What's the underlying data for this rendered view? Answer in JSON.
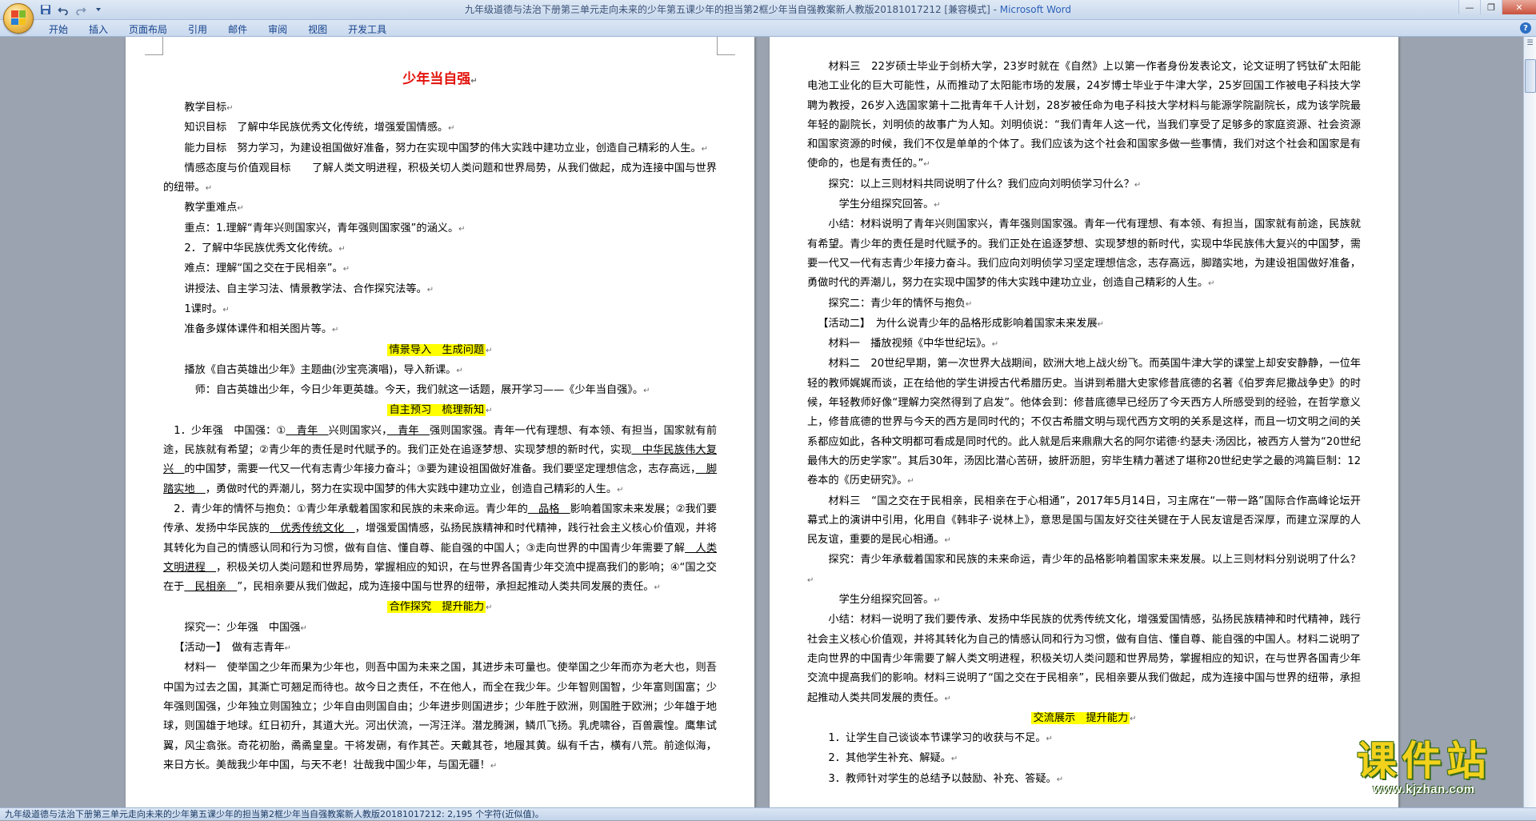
{
  "window": {
    "doc_title": "九年级道德与法治下册第三单元走向未来的少年第五课少年的担当第2框少年当自强教案新人教版20181017212 [兼容模式] - ",
    "app_name": "Microsoft Word"
  },
  "quick_access": {
    "save_icon": "save-icon",
    "undo_icon": "undo-icon",
    "redo_icon": "redo-icon",
    "customize_icon": "customize-qat-icon"
  },
  "ribbon": {
    "tabs": [
      "开始",
      "插入",
      "页面布局",
      "引用",
      "邮件",
      "审阅",
      "视图",
      "开发工具"
    ]
  },
  "left_page": {
    "title": "少年当自强",
    "paragraphs": {
      "p1": "教学目标",
      "p2": "知识目标　了解中华民族优秀文化传统，增强爱国情感。",
      "p3": "能力目标　努力学习，为建设祖国做好准备，努力在实现中国梦的伟大实践中建功立业，创造自己精彩的人生。",
      "p4": "情感态度与价值观目标　　了解人类文明进程，积极关切人类问题和世界局势，从我们做起，成为连接中国与世界的纽带。",
      "p5": "教学重难点",
      "p6": "重点：1.理解“青年兴则国家兴，青年强则国家强”的涵义。",
      "p7": "2．了解中华民族优秀文化传统。",
      "p8": "难点：理解“国之交在于民相亲”。",
      "p9": "讲授法、自主学习法、情景教学法、合作探究法等。",
      "p10": "1课时。",
      "p11": "准备多媒体课件和相关图片等。",
      "h1": "情景导入　生成问题",
      "p12": "播放《自古英雄出少年》主题曲(沙宝亮演唱)，导入新课。",
      "p13": "师：自古英雄出少年，今日少年更英雄。今天，我们就这一话题，展开学习——《少年当自强》。",
      "h2": "自主预习　梳理新知",
      "q1_a": "1．少年强　中国强：①",
      "q1_b1": "　青年　",
      "q1_c": "兴则国家兴，",
      "q1_b2": "　青年　",
      "q1_d": "强则国家强。青年一代有理想、有本领、有担当，国家就有前途，民族就有希望；②青少年的责任是时代赋予的。我们正处在追逐梦想、实现梦想的新时代，实现",
      "q1_b3": "　中华民族伟大复兴　",
      "q1_e": "的中国梦，需要一代又一代有志青少年接力奋斗；③要为建设祖国做好准备。我们要坚定理想信念，志存高远，",
      "q1_b4": "　脚踏实地　",
      "q1_f": "，勇做时代的弄潮儿，努力在实现中国梦的伟大实践中建功立业，创造自己精彩的人生。",
      "q2_a": "2．青少年的情怀与抱负：①青少年承载着国家和民族的未来命运。青少年的",
      "q2_b1": "　品格　",
      "q2_c": "影响着国家未来发展；②我们要传承、发扬中华民族的",
      "q2_b2": "　优秀传统文化　",
      "q2_d": "，增强爱国情感，弘扬民族精神和时代精神，践行社会主义核心价值观，并将其转化为自己的情感认同和行为习惯，做有自信、懂自尊、能自强的中国人；③走向世界的中国青少年需要了解",
      "q2_b3": "　人类文明进程　",
      "q2_e": "，积极关切人类问题和世界局势，掌握相应的知识，在与世界各国青少年交流中提高我们的影响；④“国之交在于",
      "q2_b4": "　民相亲　",
      "q2_f": "”，民相亲要从我们做起，成为连接中国与世界的纽带，承担起推动人类共同发展的责任。",
      "h3": "合作探究　提升能力",
      "p14": "探究一：少年强　中国强",
      "p15": "【活动一】　做有志青年",
      "p16": "材料一　使举国之少年而果为少年也，则吾中国为未来之国，其进步未可量也。使举国之少年而亦为老大也，则吾中国为过去之国，其澌亡可翘足而待也。故今日之责任，不在他人，而全在我少年。少年智则国智，少年富则国富；少年强则国强，少年独立则国独立；少年自由则国自由；少年进步则国进步；少年胜于欧洲，则国胜于欧洲；少年雄于地球，则国雄于地球。红日初升，其道大光。河出伏流，一泻汪洋。潜龙腾渊，鳞爪飞扬。乳虎啸谷，百兽震惶。鹰隼试翼，风尘翕张。奇花初胎，矞矞皇皇。干将发硎，有作其芒。天戴其苍，地履其黄。纵有千古，横有八荒。前途似海，来日方长。美哉我少年中国，与天不老！壮哉我中国少年，与国无疆！"
    }
  },
  "right_page": {
    "paragraphs": {
      "r1": "材料三　22岁硕士毕业于剑桥大学，23岁时就在《自然》上以第一作者身份发表论文，论文证明了钙钛矿太阳能电池工业化的巨大可能性，从而推动了太阳能市场的发展，24岁博士毕业于牛津大学，25岁回国工作被电子科技大学聘为教授，26岁入选国家第十二批青年千人计划，28岁被任命为电子科技大学材料与能源学院副院长，成为该学院最年轻的副院长，刘明侦的故事广为人知。刘明侦说：“我们青年人这一代，当我们享受了足够多的家庭资源、社会资源和国家资源的时候，我们不仅是单单的个体了。我们应该为这个社会和国家多做一些事情，我们对这个社会和国家是有使命的，也是有责任的。”",
      "r2": "探究：以上三则材料共同说明了什么？我们应向刘明侦学习什么？",
      "r3": "学生分组探究回答。",
      "r4": "小结：材料说明了青年兴则国家兴，青年强则国家强。青年一代有理想、有本领、有担当，国家就有前途，民族就有希望。青少年的责任是时代赋予的。我们正处在追逐梦想、实现梦想的新时代，实现中华民族伟大复兴的中国梦，需要一代又一代有志青少年接力奋斗。我们应向刘明侦学习坚定理想信念，志存高远，脚踏实地，为建设祖国做好准备，勇做时代的弄潮儿，努力在实现中国梦的伟大实践中建功立业，创造自己精彩的人生。",
      "r5": "探究二：青少年的情怀与抱负",
      "r6": "【活动二】　为什么说青少年的品格形成影响着国家未来发展",
      "r7": "材料一　播放视频《中华世纪坛》。",
      "r8": "材料二　20世纪早期，第一次世界大战期间，欧洲大地上战火纷飞。而英国牛津大学的课堂上却安安静静，一位年轻的教师娓娓而谈，正在给他的学生讲授古代希腊历史。当讲到希腊大史家修昔底德的名著《伯罗奔尼撒战争史》的时候，年轻教师好像“理解力突然得到了启发”。他体会到：修昔底德早已经历了今天西方人所感受到的经验，在哲学意义上，修昔底德的世界与今天的西方是同时代的；不仅古希腊文明与现代西方文明的关系是这样，而且一切文明之间的关系都应如此，各种文明都可看成是同时代的。此人就是后来鼎鼎大名的阿尔诺德·约瑟夫·汤因比，被西方人誉为“20世纪最伟大的历史学家”。其后30年，汤因比潜心苦研，披肝沥胆，穷毕生精力著述了堪称20世纪史学之最的鸿篇巨制：12卷本的《历史研究》。",
      "r9": "材料三　“国之交在于民相亲，民相亲在于心相通”，2017年5月14日，习主席在“一带一路”国际合作高峰论坛开幕式上的演讲中引用，化用自《韩非子·说林上》，意思是国与国友好交往关键在于人民友谊是否深厚，而建立深厚的人民友谊，重要的是民心相通。",
      "r10": "探究：青少年承载着国家和民族的未来命运，青少年的品格影响着国家未来发展。以上三则材料分别说明了什么？",
      "r11": "学生分组探究回答。",
      "r12": "小结：材料一说明了我们要传承、发扬中华民族的优秀传统文化，增强爱国情感，弘扬民族精神和时代精神，践行社会主义核心价值观，并将其转化为自己的情感认同和行为习惯，做有自信、懂自尊、能自强的中国人。材料二说明了走向世界的中国青少年需要了解人类文明进程，积极关切人类问题和世界局势，掌握相应的知识，在与世界各国青少年交流中提高我们的影响。材料三说明了“国之交在于民相亲”，民相亲要从我们做起，成为连接中国与世界的纽带，承担起推动人类共同发展的责任。",
      "h4": "交流展示　提升能力",
      "r13": "1．让学生自己谈谈本节课学习的收获与不足。",
      "r14": "2．其他学生补充、解疑。",
      "r15": "3．教师针对学生的总结予以鼓励、补充、答疑。"
    }
  },
  "status_bar": {
    "text": "九年级道德与法治下册第三单元走向未来的少年第五课少年的担当第2框少年当自强教案新人教版20181017212: 2,195 个字符(近似值)。"
  },
  "watermark": {
    "text": "课件站",
    "url": "www.kjzhan.com"
  },
  "colors": {
    "title_red": "#e3120b",
    "highlight_yellow": "#ffff00",
    "watermark_yellow": "#f2d21b"
  }
}
